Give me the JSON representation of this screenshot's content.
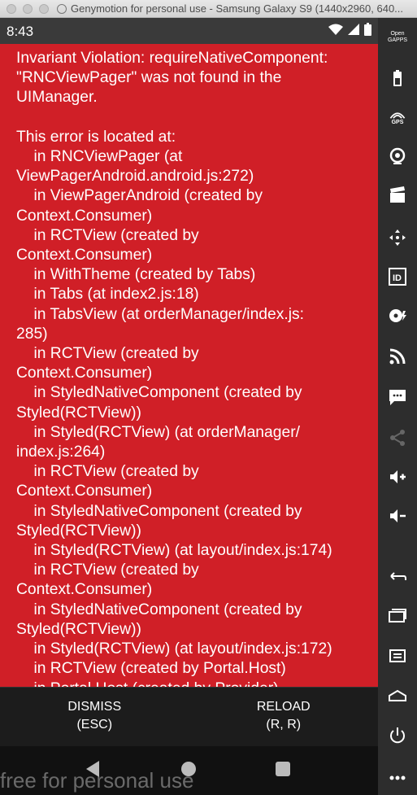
{
  "window": {
    "title": "Genymotion for personal use - Samsung Galaxy S9 (1440x2960, 640..."
  },
  "status_bar": {
    "time": "8:43"
  },
  "error": {
    "text": "Invariant Violation: requireNativeComponent:\n\"RNCViewPager\" was not found in the\nUIManager.\n\nThis error is located at:\n    in RNCViewPager (at\nViewPagerAndroid.android.js:272)\n    in ViewPagerAndroid (created by\nContext.Consumer)\n    in RCTView (created by\nContext.Consumer)\n    in WithTheme (created by Tabs)\n    in Tabs (at index2.js:18)\n    in TabsView (at orderManager/index.js:\n285)\n    in RCTView (created by\nContext.Consumer)\n    in StyledNativeComponent (created by\nStyled(RCTView))\n    in Styled(RCTView) (at orderManager/\nindex.js:264)\n    in RCTView (created by\nContext.Consumer)\n    in StyledNativeComponent (created by\nStyled(RCTView))\n    in Styled(RCTView) (at layout/index.js:174)\n    in RCTView (created by\nContext.Consumer)\n    in StyledNativeComponent (created by\nStyled(RCTView))\n    in Styled(RCTView) (at layout/index.js:172)\n    in RCTView (created by Portal.Host)\n    in Portal.Host (created by Provider)"
  },
  "buttons": {
    "dismiss": "DISMISS\n(ESC)",
    "reload": "RELOAD\n(R, R)"
  },
  "watermark": "free for personal use",
  "toolbar": {
    "gapps_label": "Open\nGAPPS",
    "gps_label": "GPS"
  },
  "colors": {
    "error_background": "#d01f27",
    "toolbar_background": "#2d2d2d"
  }
}
